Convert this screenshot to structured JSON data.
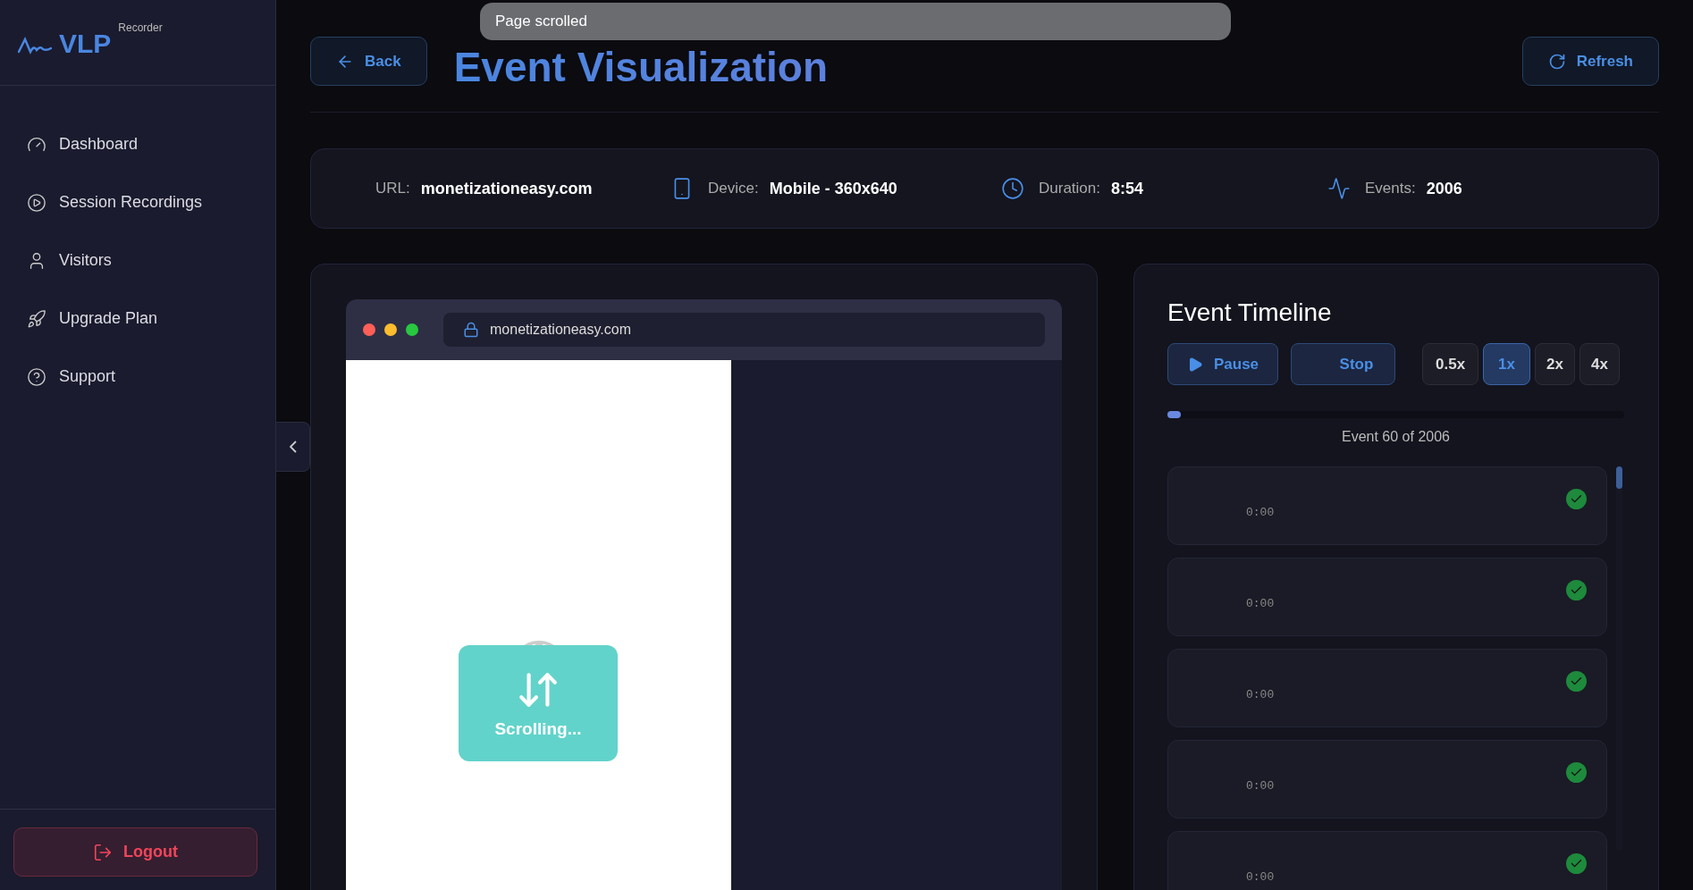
{
  "sidebar": {
    "logo": {
      "name": "VLP",
      "tag": "Recorder"
    },
    "items": [
      {
        "label": "Dashboard",
        "selected": false
      },
      {
        "label": "Session Recordings",
        "selected": false
      },
      {
        "label": "Visitors",
        "selected": false
      },
      {
        "label": "Upgrade Plan",
        "selected": false
      },
      {
        "label": "Support",
        "selected": false
      }
    ],
    "logout": "Logout"
  },
  "header": {
    "back": "Back",
    "title": "Event Visualization",
    "refresh": "Refresh"
  },
  "toast": "Page scrolled",
  "info": [
    {
      "label": "URL:",
      "value": "monetizationeasy.com"
    },
    {
      "label": "Device:",
      "value": "Mobile - 360x640"
    },
    {
      "label": "Duration:",
      "value": "8:54"
    },
    {
      "label": "Events:",
      "value": "2006"
    }
  ],
  "preview": {
    "address": "monetizationeasy.com",
    "overlay": "Scrolling..."
  },
  "timeline": {
    "title": "Event Timeline",
    "pause": "Pause",
    "stop": "Stop",
    "speeds": [
      {
        "label": "0.5x",
        "selected": false
      },
      {
        "label": "1x",
        "selected": true
      },
      {
        "label": "2x",
        "selected": false
      },
      {
        "label": "4x",
        "selected": false
      }
    ],
    "progress": {
      "level": 0.03
    },
    "counter": "Event 60 of 2006",
    "events": [
      {
        "time": "0:00"
      },
      {
        "time": "0:00"
      },
      {
        "time": "0:00"
      },
      {
        "time": "0:00"
      },
      {
        "time": "0:00"
      }
    ]
  }
}
